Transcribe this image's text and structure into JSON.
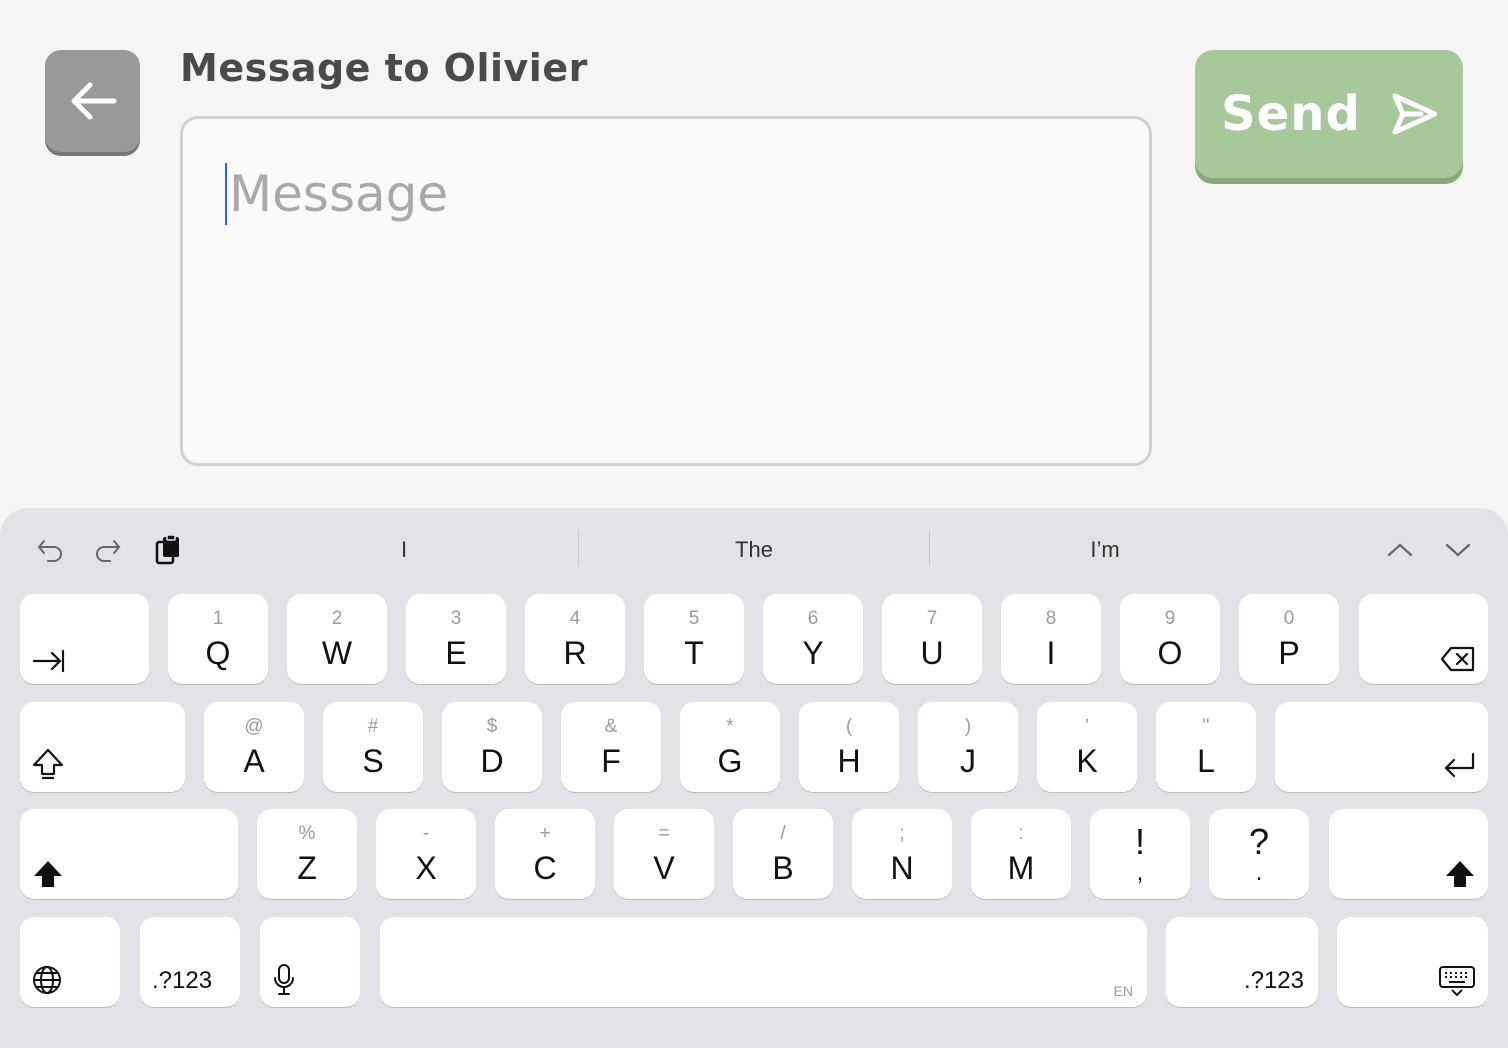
{
  "header": {
    "back_icon": "arrow-left-icon",
    "title": "Message to Olivier",
    "send_label": "Send",
    "send_icon": "send-arrow-icon",
    "accent_color": "#a6c89b"
  },
  "composer": {
    "placeholder": "Message"
  },
  "keyboard": {
    "toolbar": {
      "undo_icon": "undo-icon",
      "redo_icon": "redo-icon",
      "paste_icon": "clipboard-icon",
      "suggestions": [
        "I",
        "The",
        "I’m"
      ],
      "prev_icon": "chevron-up-icon",
      "next_icon": "chevron-down-icon"
    },
    "row1": [
      {
        "sec": "1",
        "pri": "Q"
      },
      {
        "sec": "2",
        "pri": "W"
      },
      {
        "sec": "3",
        "pri": "E"
      },
      {
        "sec": "4",
        "pri": "R"
      },
      {
        "sec": "5",
        "pri": "T"
      },
      {
        "sec": "6",
        "pri": "Y"
      },
      {
        "sec": "7",
        "pri": "U"
      },
      {
        "sec": "8",
        "pri": "I"
      },
      {
        "sec": "9",
        "pri": "O"
      },
      {
        "sec": "0",
        "pri": "P"
      }
    ],
    "row2": [
      {
        "sec": "@",
        "pri": "A"
      },
      {
        "sec": "#",
        "pri": "S"
      },
      {
        "sec": "$",
        "pri": "D"
      },
      {
        "sec": "&",
        "pri": "F"
      },
      {
        "sec": "*",
        "pri": "G"
      },
      {
        "sec": "(",
        "pri": "H"
      },
      {
        "sec": ")",
        "pri": "J"
      },
      {
        "sec": "'",
        "pri": "K"
      },
      {
        "sec": "\"",
        "pri": "L"
      }
    ],
    "row3": [
      {
        "sec": "%",
        "pri": "Z"
      },
      {
        "sec": "-",
        "pri": "X"
      },
      {
        "sec": "+",
        "pri": "C"
      },
      {
        "sec": "=",
        "pri": "V"
      },
      {
        "sec": "/",
        "pri": "B"
      },
      {
        "sec": ";",
        "pri": "N"
      },
      {
        "sec": ":",
        "pri": "M"
      }
    ],
    "punct": [
      {
        "pri": "!",
        "sec": ","
      },
      {
        "pri": "?",
        "sec": "."
      }
    ],
    "numbers_label": ".?123",
    "space_lang": "EN"
  }
}
